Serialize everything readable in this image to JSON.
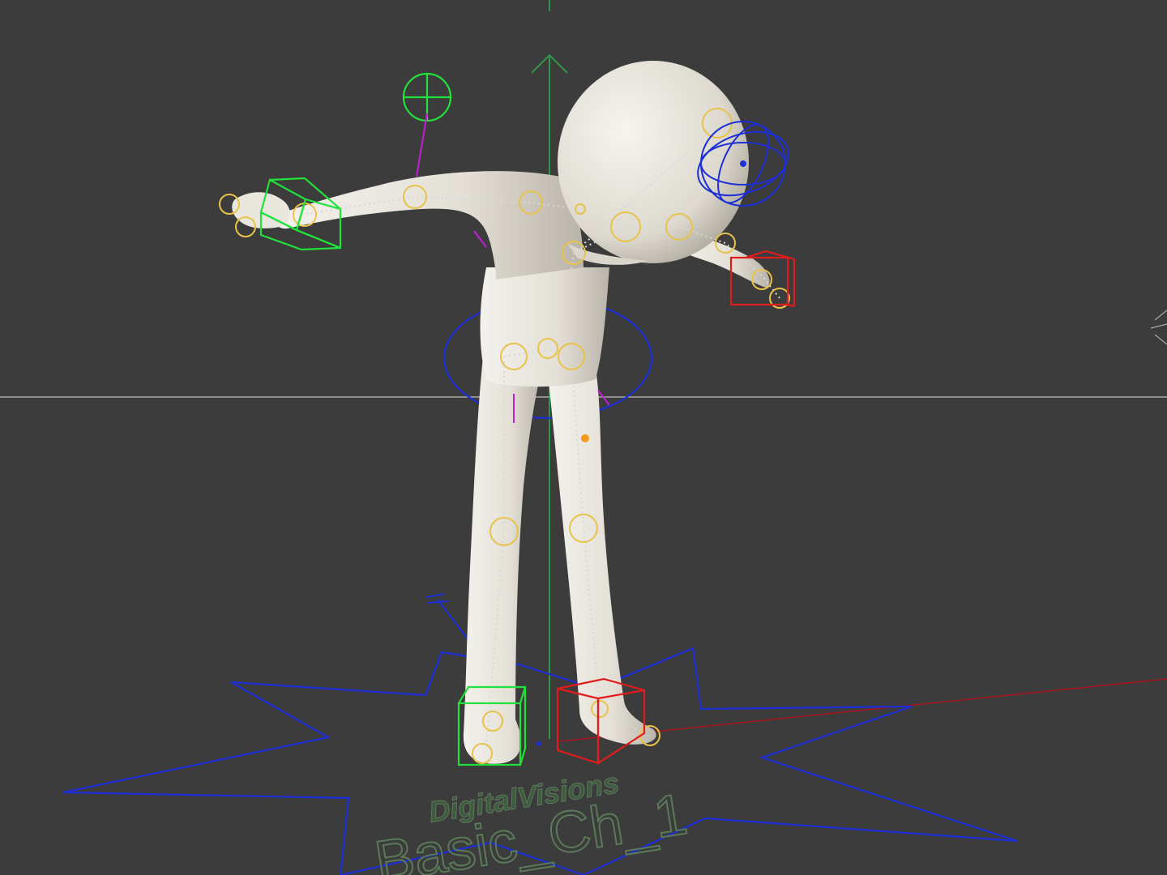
{
  "scene": {
    "background": "#3c3c3c",
    "colors": {
      "grid": "#a9a9a9",
      "y_axis": "#2fb34a",
      "x_axis": "#a8141e",
      "character": "#e3e0d8",
      "ik_green": "#22e13a",
      "ik_red": "#e21b1b",
      "control_blue": "#1c2ed6",
      "joint": "#e8c24a",
      "pole_magenta": "#c21ed6",
      "orange_dot": "#f39a1d"
    },
    "icons": [
      "look-at-target-icon",
      "ik-handle-box-icon",
      "head-rotate-gizmo-icon",
      "cog-ring-icon",
      "star-root-control-icon",
      "axis-arrow-icon"
    ]
  },
  "rig": {
    "brand_text": "DigitalVisions",
    "name_text": "Basic_Ch_1"
  }
}
